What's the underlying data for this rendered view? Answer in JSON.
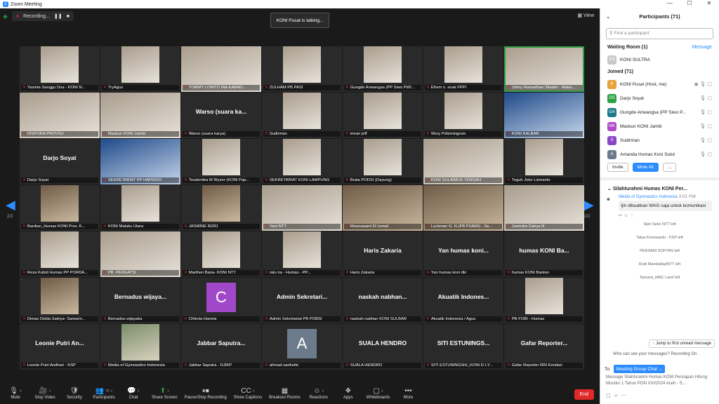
{
  "window": {
    "title": "Zoom Meeting",
    "controls": [
      "—",
      "☐",
      "✕"
    ]
  },
  "top": {
    "recording_label": "Recording...",
    "talking": "KONI Pusat is talking...",
    "view_label": "View"
  },
  "pages": {
    "left": "2/2",
    "right": "2/2"
  },
  "tiles": [
    {
      "name": "Yasinta Sanggu Doa - KONI N...",
      "video": true
    },
    {
      "name": "TryAgus",
      "video": true
    },
    {
      "name": "TOMMY LOWTO INA KABAD...",
      "video": true,
      "wide": true
    },
    {
      "name": "ZULHAM PB PASI",
      "video": true
    },
    {
      "name": "Gungde Ariwangsa (PP Siwo PWI...",
      "video": true
    },
    {
      "name": "Efrem n. soak FPPI",
      "video": true
    },
    {
      "name": "Johny Ramadhan Silalahi - Waka...",
      "video": true,
      "wide": true,
      "highlight": true
    },
    {
      "name": "DISPORA PROVSU",
      "video": true,
      "wide": true
    },
    {
      "name": "Maskun KONI Jambi",
      "video": true,
      "wide": true
    },
    {
      "name": "Warso (suara karya)",
      "big": "Warso (suara ka..."
    },
    {
      "name": "Sudirman",
      "video": true
    },
    {
      "name": "imran jeff",
      "video": true
    },
    {
      "name": "Wury Pebriningrum",
      "video": true
    },
    {
      "name": "KONI KALBAR",
      "video": true,
      "wide": true,
      "tone": "blue"
    },
    {
      "name": "Darjo Soyat",
      "big": "Darjo Soyat"
    },
    {
      "name": "SEKRETARIAT PP HAPKIDO",
      "video": true,
      "wide": true,
      "tone": "blue"
    },
    {
      "name": "Tesalonika M Wyzer (KONI Pap...",
      "video": true
    },
    {
      "name": "SEKRETARIAT KONI LAMPUNG",
      "video": true
    },
    {
      "name": "Brata PODSI (Dayung)",
      "video": true
    },
    {
      "name": "KONI SULAWESI TENGAH",
      "video": true,
      "wide": true
    },
    {
      "name": "Teguh Joko Lismanto",
      "video": true
    },
    {
      "name": "Bardian_Humas KONI Prov. K...",
      "video": true,
      "dark": true
    },
    {
      "name": "KONI Maluku Utara",
      "video": true
    },
    {
      "name": "JASMINE RIZKI",
      "video": true,
      "dark": true
    },
    {
      "name": "Yani NTT",
      "video": true,
      "wide": true
    },
    {
      "name": "Mounaward Di Ismail",
      "video": true,
      "wide": true,
      "dark": true
    },
    {
      "name": "Luckman G. N (PB PSAWI) - Se...",
      "video": true,
      "wide": true,
      "dark": true
    },
    {
      "name": "Junindra Cahya N",
      "video": true,
      "wide": true
    },
    {
      "name": "Reza Kabid Humas PP PORDA...",
      "video": true
    },
    {
      "name": "PB. PERGATSI",
      "video": true,
      "wide": true
    },
    {
      "name": "Marthen Bana- KONI NTT",
      "video": true
    },
    {
      "name": "ratu ira - Humas - PP...",
      "video": true
    },
    {
      "name": "Haris Zakaria",
      "big": "Haris Zakaria"
    },
    {
      "name": "Yan humas koni dki",
      "big": "Yan humas koni..."
    },
    {
      "name": "humas KONI Banten",
      "big": "humas KONI Ba..."
    },
    {
      "name": "Dimas Didda Satriya- Samarin...",
      "video": true,
      "dark": true
    },
    {
      "name": "Bernadus wijayaka",
      "big": "Bernadus wijaya..."
    },
    {
      "name": "Chikola Haneta",
      "letter": "C",
      "letter_color": "#a048c8"
    },
    {
      "name": "Admin Sekretariat PB POBSI",
      "big": "Admin Sekretari..."
    },
    {
      "name": "naskah nabhan KONI SULBAR",
      "big": "naskah nabhan..."
    },
    {
      "name": "Akuatik Indonesia / Agus",
      "big": "Akuatik Indones..."
    },
    {
      "name": "PB FOBI - Humas",
      "video": true
    },
    {
      "name": "Leonie Putri Andhari - KSP",
      "big": "Leonie Putri An..."
    },
    {
      "name": "Media of Gymnastics Indonesia",
      "video": true,
      "tone": "green"
    },
    {
      "name": "Jabbar Saputra - DJIKP",
      "big": "Jabbar Saputra..."
    },
    {
      "name": "ahmad saefudin",
      "letter": "A",
      "letter_color": "#6c7b8b"
    },
    {
      "name": "SUALA HENDRO",
      "big": "SUALA HENDRO"
    },
    {
      "name": "SITI ESTUNINGSIH_KONI D.I.Y...",
      "big": "SITI ESTUNINGS..."
    },
    {
      "name": "Gafar Reporter RRI Kendari",
      "big": "Gafar Reporter..."
    }
  ],
  "toolbar": [
    {
      "label": "Mute",
      "icon": "🎙",
      "caret": true
    },
    {
      "label": "Stop Video",
      "icon": "🎥",
      "caret": true
    },
    {
      "label": "Security",
      "icon": "🛡"
    },
    {
      "label": "Participants",
      "icon": "👥",
      "badge": "72",
      "caret": true
    },
    {
      "label": "Chat",
      "icon": "💬",
      "caret": true
    },
    {
      "label": "Share Screen",
      "icon": "⬆",
      "caret": true,
      "green": true
    },
    {
      "label": "Pause/Stop Recording",
      "icon": "⏸⏹"
    },
    {
      "label": "Show Captions",
      "icon": "CC",
      "caret": true
    },
    {
      "label": "Breakout Rooms",
      "icon": "▦"
    },
    {
      "label": "Reactions",
      "icon": "☺",
      "caret": true
    },
    {
      "label": "Apps",
      "icon": "❖"
    },
    {
      "label": "Whiteboards",
      "icon": "▢",
      "caret": true
    },
    {
      "label": "More",
      "icon": "•••"
    }
  ],
  "end_label": "End",
  "panel": {
    "title": "Participants (71)",
    "search_placeholder": "Find a participant",
    "waiting_label": "Waiting Room (1)",
    "message_label": "Message",
    "waiting": [
      {
        "initials": "KS",
        "name": "KONI SULTRA",
        "color": "#c8c8c8"
      }
    ],
    "joined_label": "Joined (71)",
    "joined": [
      {
        "initials": "K",
        "name": "KONI Pusat (Host, me)",
        "color": "#e8a33a",
        "icons": "◉ 🎙 ▢"
      },
      {
        "initials": "DS",
        "name": "Darjo Soyat",
        "color": "#2ea043",
        "icons": "🎙 ▢"
      },
      {
        "initials": "GA",
        "name": "Gungde Ariwangsa (PP Siwo P...",
        "color": "#1f7a8c",
        "icons": "🎙 ▢"
      },
      {
        "initials": "MK",
        "name": "Maskun KONI Jambi",
        "color": "#b048c8",
        "icons": "🎙 ▢"
      },
      {
        "initials": "S",
        "name": "Sudirman",
        "color": "#8a48c8",
        "icons": "🎙 ▢"
      },
      {
        "initials": "A",
        "name": "Amanda Humas Koni Sulut",
        "color": "#6c7b8b",
        "icons": "🎙 ▢"
      }
    ],
    "invite": "Invite",
    "mute_all": "Mute All",
    "more": "...",
    "chat_title": "Silahturahmi Humas KONI Per...",
    "chat_sender": "Media of Gymnastics Indonesia",
    "chat_time": "3:01 PM",
    "chat_text": "Ijin dibuatkan WAG saja untuk komunikasi",
    "left_lines": [
      "Sipri Seko NTT left",
      "Tatya Koeswanto - KSP left",
      "PERSANI SOFYAN left",
      "Rudi Mandaling/NTT left",
      "Tamami_MNC Land left"
    ],
    "jump_label": "Jump to first unread message",
    "who_label": "Who can see your messages? Recording On",
    "to_label": "To:",
    "to_value": "Meeting Group Chat",
    "draft": "Message Silahturahmi Humas KONI Persiapan Hitung Mundur 1 Tahun PON XXI/2024 Aceh - S..."
  }
}
